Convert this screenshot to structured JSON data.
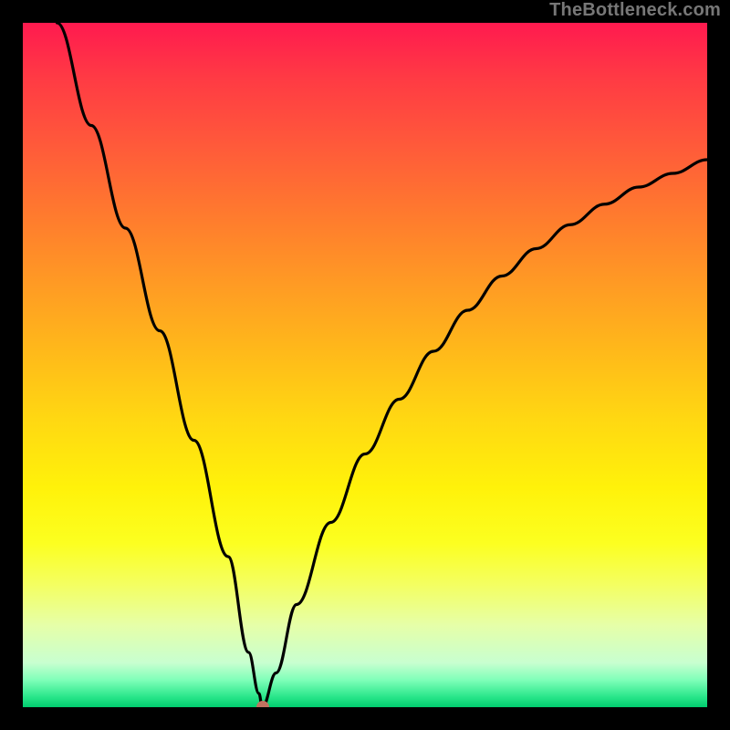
{
  "watermark": "TheBottleneck.com",
  "chart_data": {
    "type": "line",
    "title": "",
    "xlabel": "",
    "ylabel": "",
    "xlim": [
      0,
      100
    ],
    "ylim": [
      0,
      100
    ],
    "grid": false,
    "series": [
      {
        "name": "curve",
        "x": [
          5,
          10,
          15,
          20,
          25,
          30,
          33,
          34.5,
          35,
          37,
          40,
          45,
          50,
          55,
          60,
          65,
          70,
          75,
          80,
          85,
          90,
          95,
          100
        ],
        "y": [
          100,
          85,
          70,
          55,
          39,
          22,
          8,
          2,
          0,
          5,
          15,
          27,
          37,
          45,
          52,
          58,
          63,
          67,
          70.5,
          73.5,
          76,
          78,
          80
        ]
      }
    ],
    "marker": {
      "x": 35,
      "y": 0
    },
    "gradient_colors": {
      "top": "#ff1a4f",
      "mid": "#fff20a",
      "bottom": "#00cc6e"
    }
  }
}
